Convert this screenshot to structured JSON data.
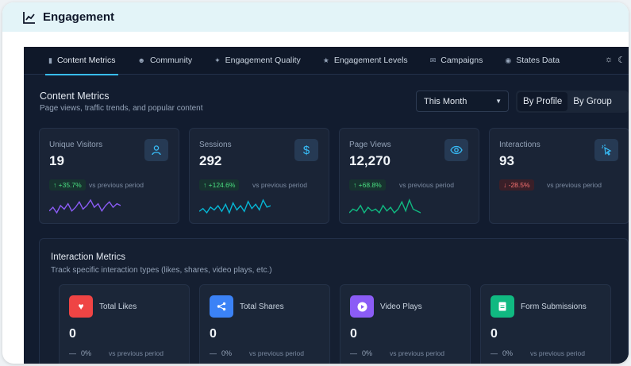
{
  "header": {
    "title": "Engagement",
    "icon": "trend-chart-icon"
  },
  "tabs": [
    {
      "label": "Content Metrics",
      "icon": "bar-chart-icon",
      "active": true
    },
    {
      "label": "Community",
      "icon": "users-icon"
    },
    {
      "label": "Engagement Quality",
      "icon": "sparkle-icon"
    },
    {
      "label": "Engagement Levels",
      "icon": "trophy-icon"
    },
    {
      "label": "Campaigns",
      "icon": "mail-icon"
    },
    {
      "label": "States Data",
      "icon": "map-pin-icon"
    }
  ],
  "content": {
    "title": "Content Metrics",
    "subtitle": "Page views, traffic trends, and popular content",
    "period": "This Month",
    "toggle": {
      "by_profile": "By Profile",
      "by_group": "By Group",
      "active": "By Profile"
    }
  },
  "metrics": [
    {
      "label": "Unique Visitors",
      "value": "19",
      "change": "+35.7%",
      "direction": "up",
      "vs": "vs previous period",
      "icon": "user-icon",
      "spark_color": "#8b5cf6",
      "spark": [
        3,
        5,
        2,
        6,
        4,
        7,
        3,
        5,
        8,
        4,
        6,
        9,
        5,
        7,
        3,
        6,
        8,
        5,
        7,
        6
      ]
    },
    {
      "label": "Sessions",
      "value": "292",
      "change": "+124.6%",
      "direction": "up",
      "vs": "vs previous period",
      "icon": "dollar-icon",
      "spark_color": "#06b6d4",
      "spark": [
        4,
        6,
        3,
        7,
        5,
        8,
        4,
        9,
        3,
        10,
        5,
        8,
        4,
        11,
        6,
        9,
        5,
        12,
        7,
        8
      ]
    },
    {
      "label": "Page Views",
      "value": "12,270",
      "change": "+68.8%",
      "direction": "up",
      "vs": "vs previous period",
      "icon": "eye-icon",
      "spark_color": "#10b981",
      "spark": [
        2,
        4,
        3,
        6,
        2,
        5,
        3,
        4,
        2,
        6,
        3,
        5,
        2,
        4,
        8,
        3,
        9,
        4,
        3,
        2
      ]
    },
    {
      "label": "Interactions",
      "value": "93",
      "change": "-28.5%",
      "direction": "down",
      "vs": "vs previous period",
      "icon": "pointer-click-icon",
      "spark_color": "#f87171",
      "spark": []
    }
  ],
  "interaction": {
    "title": "Interaction Metrics",
    "subtitle": "Track specific interaction types (likes, shares, video plays, etc.)",
    "items": [
      {
        "label": "Total Likes",
        "value": "0",
        "change": "0%",
        "vs": "vs previous period",
        "icon": "heart-icon",
        "color": "#ef4444"
      },
      {
        "label": "Total Shares",
        "value": "0",
        "change": "0%",
        "vs": "vs previous period",
        "icon": "share-icon",
        "color": "#3b82f6"
      },
      {
        "label": "Video Plays",
        "value": "0",
        "change": "0%",
        "vs": "vs previous period",
        "icon": "play-icon",
        "color": "#8b5cf6"
      },
      {
        "label": "Form Submissions",
        "value": "0",
        "change": "0%",
        "vs": "vs previous period",
        "icon": "form-icon",
        "color": "#10b981"
      }
    ]
  }
}
